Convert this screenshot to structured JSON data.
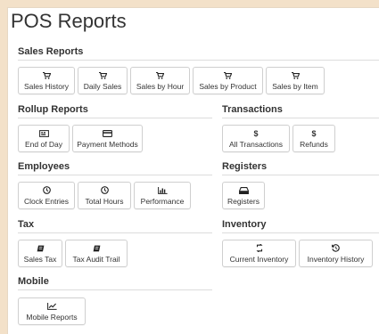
{
  "page": {
    "title": "POS Reports"
  },
  "sections": {
    "sales": {
      "title": "Sales Reports",
      "buttons": [
        {
          "label": "Sales History",
          "icon": "cart-icon"
        },
        {
          "label": "Daily Sales",
          "icon": "cart-icon"
        },
        {
          "label": "Sales by Hour",
          "icon": "cart-icon"
        },
        {
          "label": "Sales by Product",
          "icon": "cart-icon"
        },
        {
          "label": "Sales by Item",
          "icon": "cart-icon"
        }
      ]
    },
    "rollup": {
      "title": "Rollup Reports",
      "buttons": [
        {
          "label": "End of Day",
          "icon": "register-icon"
        },
        {
          "label": "Payment Methods",
          "icon": "credit-card-icon"
        }
      ]
    },
    "transactions": {
      "title": "Transactions",
      "buttons": [
        {
          "label": "All Transactions",
          "icon": "dollar-icon",
          "glyph": "$"
        },
        {
          "label": "Refunds",
          "icon": "dollar-icon",
          "glyph": "$"
        }
      ]
    },
    "employees": {
      "title": "Employees",
      "buttons": [
        {
          "label": "Clock Entries",
          "icon": "clock-icon"
        },
        {
          "label": "Total Hours",
          "icon": "clock-icon"
        },
        {
          "label": "Performance",
          "icon": "bar-chart-icon"
        }
      ]
    },
    "registers": {
      "title": "Registers",
      "buttons": [
        {
          "label": "Registers",
          "icon": "register-tray-icon"
        }
      ]
    },
    "tax": {
      "title": "Tax",
      "buttons": [
        {
          "label": "Sales Tax",
          "icon": "receipt-icon"
        },
        {
          "label": "Tax Audit Trail",
          "icon": "receipt-icon"
        }
      ]
    },
    "inventory": {
      "title": "Inventory",
      "buttons": [
        {
          "label": "Current Inventory",
          "icon": "exchange-icon"
        },
        {
          "label": "Inventory History",
          "icon": "history-icon"
        }
      ]
    },
    "mobile": {
      "title": "Mobile",
      "buttons": [
        {
          "label": "Mobile Reports",
          "icon": "line-chart-icon"
        }
      ]
    }
  },
  "colors": {
    "background": "#f3e1c9",
    "panel": "#ffffff",
    "border": "#cfcfcf",
    "text": "#333333"
  }
}
